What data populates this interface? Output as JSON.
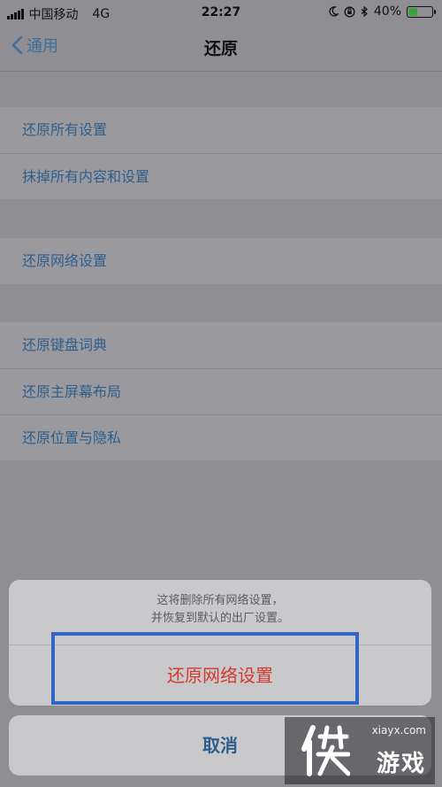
{
  "status_bar": {
    "carrier": "中国移动",
    "network": "4G",
    "time": "22:27",
    "battery_percent": "40%",
    "battery_level": 0.4,
    "icons": [
      "signal-icon",
      "moon-icon",
      "orientation-lock-icon",
      "bluetooth-icon",
      "battery-icon"
    ]
  },
  "nav": {
    "back_label": "通用",
    "title": "还原"
  },
  "groups": [
    {
      "items": [
        "还原所有设置",
        "抹掉所有内容和设置"
      ]
    },
    {
      "items": [
        "还原网络设置"
      ]
    },
    {
      "items": [
        "还原键盘词典",
        "还原主屏幕布局",
        "还原位置与隐私"
      ]
    }
  ],
  "action_sheet": {
    "message_line1": "这将删除所有网络设置，",
    "message_line2": "并恢复到默认的出厂设置。",
    "action_label": "还原网络设置",
    "cancel_label": "取消"
  },
  "watermark": {
    "site": "xiayx.com",
    "brand": "游戏"
  },
  "colors": {
    "link": "#2e5f8c",
    "destructive": "#d43a2f",
    "highlight_box": "#2f66c7"
  }
}
